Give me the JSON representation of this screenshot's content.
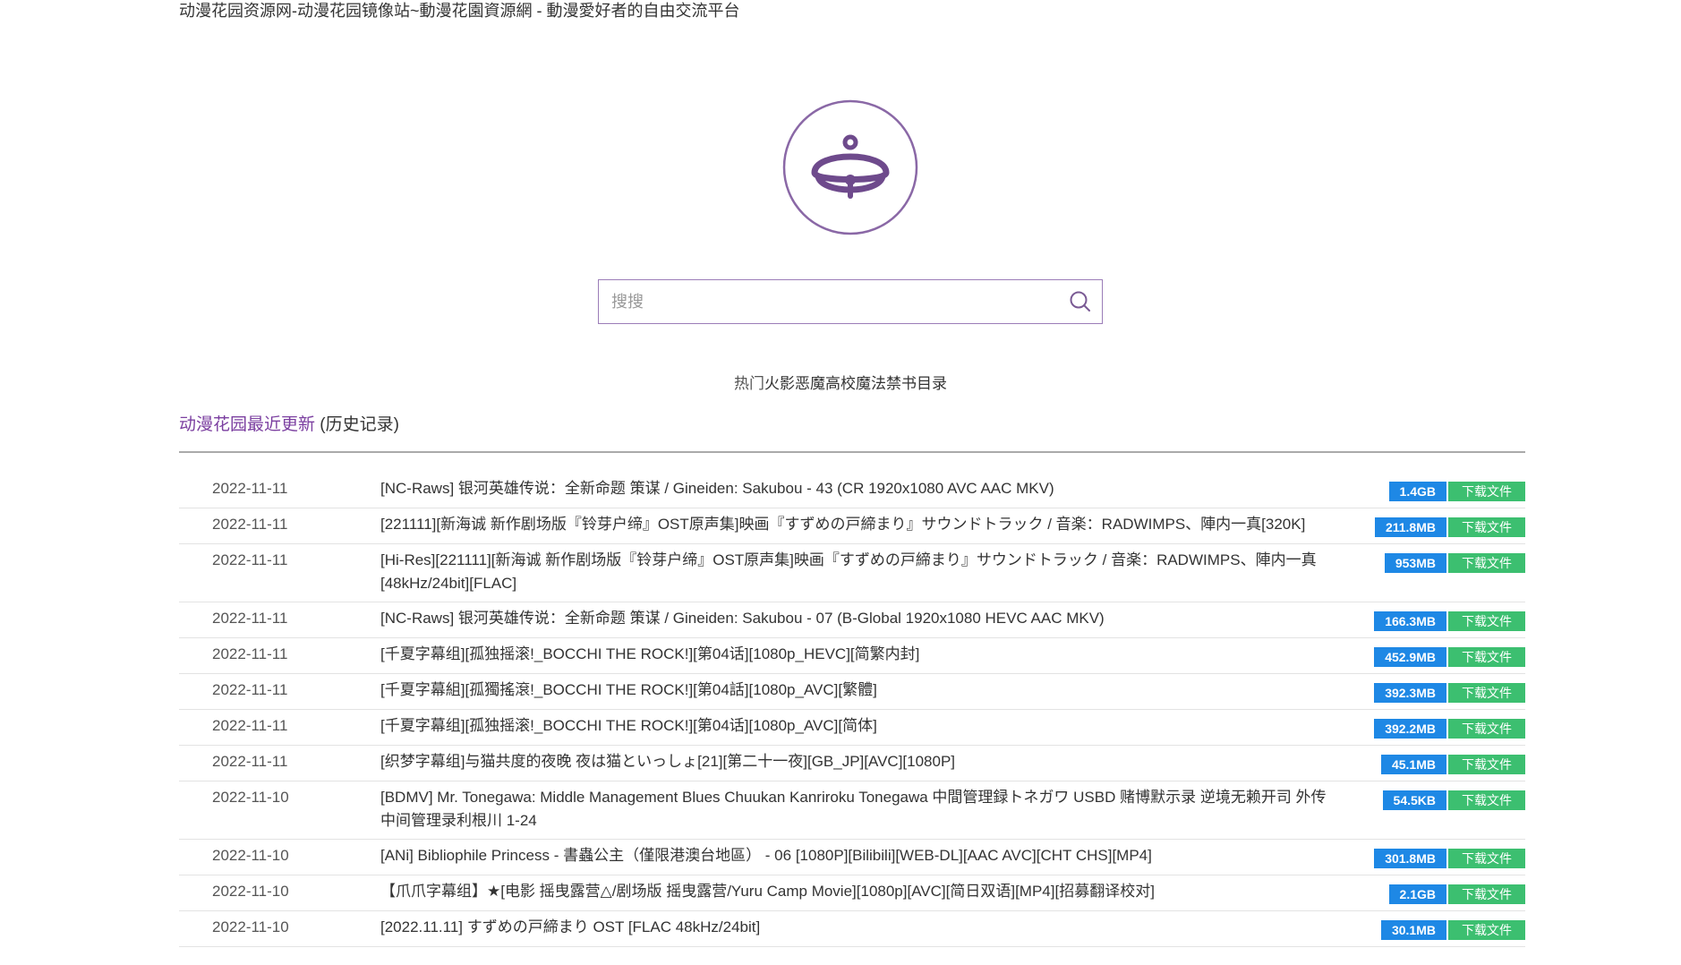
{
  "site": {
    "title": "动漫花园资源网-动漫花园镜像站~動漫花園資源網 - 動漫愛好者的自由交流平台"
  },
  "search": {
    "placeholder": "搜搜"
  },
  "hot": {
    "label": "热门",
    "items": [
      "火影",
      "恶魔",
      "高校",
      "魔法禁书目录"
    ]
  },
  "recent": {
    "title": "动漫花园最近更新",
    "history": "(历史记录)"
  },
  "colors": {
    "accent": "#7b3fa0",
    "size_badge": "#1e88e5",
    "download_button": "#3cbf70"
  },
  "rows": [
    {
      "date": "2022-11-11",
      "name": "[NC-Raws] 银河英雄传说：全新命题 策谋 / Gineiden: Sakubou - 43 (CR 1920x1080 AVC AAC MKV)",
      "size": "1.4GB",
      "download": "下载文件"
    },
    {
      "date": "2022-11-11",
      "name": "[221111][新海诚 新作剧场版『铃芽户缔』OST原声集]映画『すずめの戸締まり』サウンドトラック / 音楽：RADWIMPS、陣内一真[320K]",
      "size": "211.8MB",
      "download": "下载文件"
    },
    {
      "date": "2022-11-11",
      "name": "[Hi-Res][221111][新海诚 新作剧场版『铃芽户缔』OST原声集]映画『すずめの戸締まり』サウンドトラック / 音楽：RADWIMPS、陣内一真[48kHz/24bit][FLAC]",
      "size": "953MB",
      "download": "下载文件"
    },
    {
      "date": "2022-11-11",
      "name": "[NC-Raws] 银河英雄传说：全新命题 策谋 / Gineiden: Sakubou - 07 (B-Global 1920x1080 HEVC AAC MKV)",
      "size": "166.3MB",
      "download": "下载文件"
    },
    {
      "date": "2022-11-11",
      "name": "[千夏字幕组][孤独摇滚!_BOCCHI THE ROCK!][第04话][1080p_HEVC][简繁内封]",
      "size": "452.9MB",
      "download": "下载文件"
    },
    {
      "date": "2022-11-11",
      "name": "[千夏字幕組][孤獨搖滾!_BOCCHI THE ROCK!][第04話][1080p_AVC][繁體]",
      "size": "392.3MB",
      "download": "下载文件"
    },
    {
      "date": "2022-11-11",
      "name": "[千夏字幕组][孤独摇滚!_BOCCHI THE ROCK!][第04话][1080p_AVC][简体]",
      "size": "392.2MB",
      "download": "下载文件"
    },
    {
      "date": "2022-11-11",
      "name": "[织梦字幕组]与猫共度的夜晚 夜は猫といっしょ[21][第二十一夜][GB_JP][AVC][1080P]",
      "size": "45.1MB",
      "download": "下载文件"
    },
    {
      "date": "2022-11-10",
      "name": "[BDMV] Mr. Tonegawa: Middle Management Blues Chuukan Kanriroku Tonegawa 中間管理録トネガワ USBD 赌博默示录 逆境无赖开司 外传 中间管理录利根川 1-24",
      "size": "54.5KB",
      "download": "下载文件"
    },
    {
      "date": "2022-11-10",
      "name": "[ANi] Bibliophile Princess - 書蟲公主（僅限港澳台地區） - 06 [1080P][Bilibili][WEB-DL][AAC AVC][CHT CHS][MP4]",
      "size": "301.8MB",
      "download": "下载文件"
    },
    {
      "date": "2022-11-10",
      "name": "【爪爪字幕组】★[电影 摇曳露营△/剧场版 摇曳露营/Yuru Camp Movie][1080p][AVC][简日双语][MP4][招募翻译校对]",
      "size": "2.1GB",
      "download": "下载文件"
    },
    {
      "date": "2022-11-10",
      "name": "[2022.11.11] すずめの戸締まり OST [FLAC 48kHz/24bit]",
      "size": "30.1MB",
      "download": "下载文件"
    }
  ]
}
